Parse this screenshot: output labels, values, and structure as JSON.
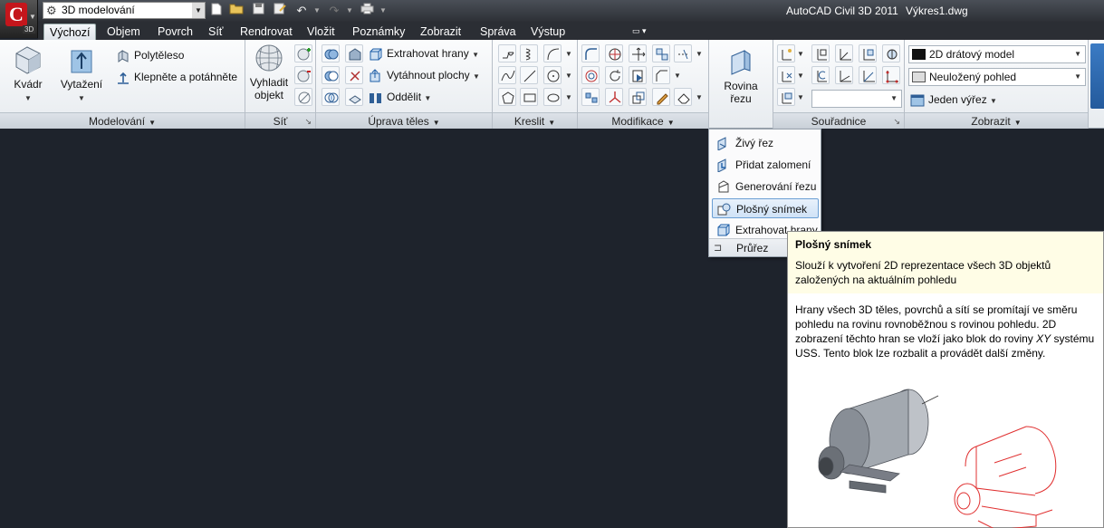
{
  "titlebar": {
    "app_badge": "3D",
    "workspace": "3D modelování",
    "app_name": "AutoCAD Civil 3D 2011",
    "document": "Výkres1.dwg"
  },
  "tabs": [
    "Výchozí",
    "Objem",
    "Povrch",
    "Síť",
    "Rendrovat",
    "Vložit",
    "Poznámky",
    "Zobrazit",
    "Správa",
    "Výstup"
  ],
  "panels": {
    "modelovani": {
      "title": "Modelování",
      "kvadr": "Kvádr",
      "vytazeni": "Vytažení",
      "polyteleso": "Polytěleso",
      "klepnete": "Klepněte a potáhněte"
    },
    "sit": {
      "title": "Síť",
      "vyhladit_line1": "Vyhladit",
      "vyhladit_line2": "objekt"
    },
    "uprava_teles": {
      "title": "Úprava těles",
      "extrahovat_hrany": "Extrahovat hrany",
      "vytahnout_plochy": "Vytáhnout plochy",
      "oddelit": "Oddělit"
    },
    "kreslit": {
      "title": "Kreslit"
    },
    "modifikace": {
      "title": "Modifikace"
    },
    "rovina": {
      "line1": "Rovina",
      "line2": "řezu"
    },
    "souradnice": {
      "title": "Souřadnice"
    },
    "zobrazit": {
      "title": "Zobrazit",
      "visual_style": "2D drátový model",
      "view": "Neuložený pohled",
      "viewport": "Jeden výřez"
    }
  },
  "rez_menu": {
    "items": [
      "Živý řez",
      "Přidat zalomení",
      "Generování řezu",
      "Plošný snímek",
      "Extrahovat hrany"
    ],
    "footer": "Průřez"
  },
  "tooltip": {
    "title": "Plošný snímek",
    "description": "Slouží k vytvoření 2D reprezentace všech 3D objektů založených na aktuálním pohledu",
    "body_part1": "Hrany všech 3D těles, povrchů a sítí se promítají ve směru pohledu na rovinu rovnoběžnou s rovinou pohledu. 2D zobrazení těchto hran se vloží jako blok do roviny ",
    "body_italic": "XY",
    "body_part2": " systému USS. Tento blok lze rozbalit a provádět další změny."
  }
}
